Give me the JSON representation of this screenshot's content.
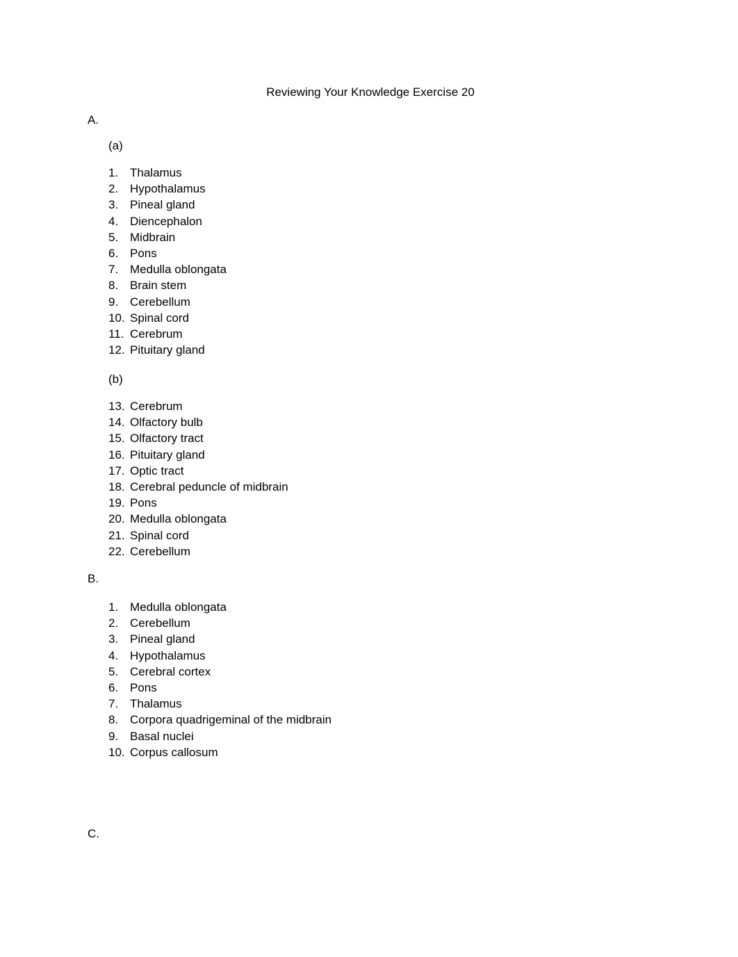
{
  "document": {
    "title": "Reviewing Your Knowledge Exercise 20",
    "sections": {
      "A": {
        "label": "A.",
        "part_a": {
          "label": "(a)",
          "items": [
            {
              "num": "1.",
              "text": "Thalamus"
            },
            {
              "num": "2.",
              "text": "Hypothalamus"
            },
            {
              "num": "3.",
              "text": "Pineal gland"
            },
            {
              "num": "4.",
              "text": "Diencephalon"
            },
            {
              "num": "5.",
              "text": "Midbrain"
            },
            {
              "num": "6.",
              "text": "Pons"
            },
            {
              "num": "7.",
              "text": "Medulla oblongata"
            },
            {
              "num": "8.",
              "text": "Brain stem"
            },
            {
              "num": "9.",
              "text": "Cerebellum"
            },
            {
              "num": "10.",
              "text": "Spinal cord"
            },
            {
              "num": "11.",
              "text": "Cerebrum"
            },
            {
              "num": "12.",
              "text": "Pituitary gland"
            }
          ]
        },
        "part_b": {
          "label": "(b)",
          "items": [
            {
              "num": "13.",
              "text": "Cerebrum"
            },
            {
              "num": "14.",
              "text": "Olfactory bulb"
            },
            {
              "num": "15.",
              "text": "Olfactory tract"
            },
            {
              "num": "16.",
              "text": "Pituitary gland"
            },
            {
              "num": "17.",
              "text": "Optic tract"
            },
            {
              "num": "18.",
              "text": "Cerebral peduncle of midbrain"
            },
            {
              "num": "19.",
              "text": "Pons"
            },
            {
              "num": "20.",
              "text": "Medulla oblongata"
            },
            {
              "num": "21.",
              "text": "Spinal cord"
            },
            {
              "num": "22.",
              "text": "Cerebellum"
            }
          ]
        }
      },
      "B": {
        "label": "B.",
        "items": [
          {
            "num": "1.",
            "text": "Medulla oblongata"
          },
          {
            "num": "2.",
            "text": "Cerebellum"
          },
          {
            "num": "3.",
            "text": "Pineal gland"
          },
          {
            "num": "4.",
            "text": "Hypothalamus"
          },
          {
            "num": "5.",
            "text": "Cerebral cortex"
          },
          {
            "num": "6.",
            "text": "Pons"
          },
          {
            "num": "7.",
            "text": "Thalamus"
          },
          {
            "num": "8.",
            "text": "Corpora quadrigeminal of the midbrain"
          },
          {
            "num": "9.",
            "text": "Basal nuclei"
          },
          {
            "num": "10.",
            "text": "Corpus callosum"
          }
        ]
      },
      "C": {
        "label": "C."
      }
    }
  }
}
